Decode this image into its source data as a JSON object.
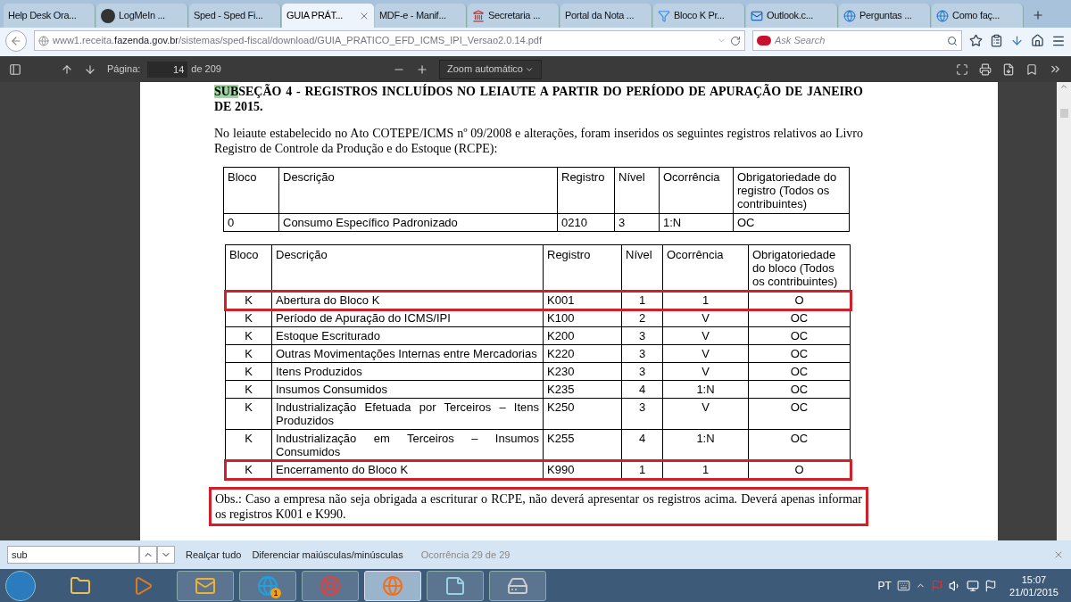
{
  "tabs": [
    {
      "label": "Help Desk Ora...",
      "kind": "plain",
      "selected": false
    },
    {
      "label": "LogMeIn ...",
      "kind": "logo",
      "selected": false
    },
    {
      "label": "Sped - Sped Fi...",
      "kind": "plain",
      "selected": false
    },
    {
      "label": "GUIA PRÁT...",
      "kind": "plain",
      "selected": true
    },
    {
      "label": "MDF-e - Manif...",
      "kind": "plain",
      "selected": false
    },
    {
      "label": "Secretaria ...",
      "kind": "bank",
      "selected": false
    },
    {
      "label": "Portal da Nota ...",
      "kind": "plain",
      "selected": false
    },
    {
      "label": "Bloco K Pr...",
      "kind": "funnel",
      "selected": false
    },
    {
      "label": "Outlook.c...",
      "kind": "mail",
      "selected": false
    },
    {
      "label": "Perguntas ...",
      "kind": "globe",
      "selected": false
    },
    {
      "label": "Como faç...",
      "kind": "globe",
      "selected": false
    }
  ],
  "address": {
    "prefix": "www1.receita.",
    "domain": "fazenda.gov.br",
    "path": "/sistemas/sped-fiscal/download/GUIA_PRATICO_EFD_ICMS_IPI_Versao2.0.14.pdf"
  },
  "search": {
    "placeholder": "Ask Search"
  },
  "pdf_toolbar": {
    "page_label": "Página:",
    "page": "14",
    "page_total": "de 209",
    "zoom": "Zoom automático"
  },
  "document": {
    "heading_match": "SUB",
    "heading_rest": "SEÇÃO 4 - REGISTROS INCLUÍDOS NO LEIAUTE A PARTIR DO PERÍODO DE APURAÇÃO DE JANEIRO DE 2015.",
    "paragraph": "No leiaute estabelecido no Ato COTEPE/ICMS nº 09/2008 e alterações, foram inseridos os seguintes registros relativos ao Livro Registro de Controle da Produção e do Estoque (RCPE):",
    "table_1": {
      "columns": [
        "Bloco",
        "Descrição",
        "Registro",
        "Nível",
        "Ocorrência",
        "Obrigatoriedade do registro (Todos os contribuintes)"
      ],
      "rows": [
        {
          "cells": [
            "0",
            "Consumo Específico Padronizado",
            "0210",
            "3",
            "1:N",
            "OC"
          ]
        }
      ]
    },
    "table_2": {
      "columns": [
        "Bloco",
        "Descrição",
        "Registro",
        "Nível",
        "Ocorrência",
        "Obrigatoriedade do bloco (Todos os contribuintes)"
      ],
      "rows": [
        {
          "cells": [
            "K",
            "Abertura do Bloco K",
            "K001",
            "1",
            "1",
            "O"
          ],
          "highlighted": true
        },
        {
          "cells": [
            "K",
            "Período de Apuração do ICMS/IPI",
            "K100",
            "2",
            "V",
            "OC"
          ],
          "highlighted": false
        },
        {
          "cells": [
            "K",
            "Estoque Escriturado",
            "K200",
            "3",
            "V",
            "OC"
          ],
          "highlighted": false
        },
        {
          "cells": [
            "K",
            "Outras Movimentações Internas entre Mercadorias",
            "K220",
            "3",
            "V",
            "OC"
          ],
          "highlighted": false
        },
        {
          "cells": [
            "K",
            "Itens Produzidos",
            "K230",
            "3",
            "V",
            "OC"
          ],
          "highlighted": false
        },
        {
          "cells": [
            "K",
            "Insumos Consumidos",
            "K235",
            "4",
            "1:N",
            "OC"
          ],
          "highlighted": false
        },
        {
          "cells": [
            "K",
            "Industrialização Efetuada por Terceiros – Itens Produzidos",
            "K250",
            "3",
            "V",
            "OC"
          ],
          "highlighted": false
        },
        {
          "cells": [
            "K",
            "Industrialização em Terceiros – Insumos Consumidos",
            "K255",
            "4",
            "1:N",
            "OC"
          ],
          "highlighted": false
        },
        {
          "cells": [
            "K",
            "Encerramento do Bloco K",
            "K990",
            "1",
            "1",
            "O"
          ],
          "highlighted": true
        }
      ]
    },
    "note": {
      "text": "Obs.: Caso a empresa não seja obrigada a escriturar o RCPE, não deverá apresentar os registros acima. Deverá apenas informar os registros K001 e K990.",
      "highlighted": true
    }
  },
  "find_bar": {
    "value": "sub",
    "highlight_all": "Realçar tudo",
    "match_case": "Diferenciar maiúsculas/minúsculas",
    "status": "Ocorrência 29 de 29"
  },
  "taskbar": {
    "items": [
      {
        "kind": "folder",
        "selected": false
      },
      {
        "kind": "media",
        "selected": false
      },
      {
        "kind": "outlook",
        "selected": false
      },
      {
        "kind": "skype",
        "selected": false,
        "badge": "1"
      },
      {
        "kind": "lifebuoy",
        "selected": false
      },
      {
        "kind": "firefox",
        "selected": true
      },
      {
        "kind": "notes",
        "selected": false
      },
      {
        "kind": "drive",
        "selected": false
      }
    ],
    "language": "PT",
    "time": "15:07",
    "date": "21/01/2015"
  }
}
